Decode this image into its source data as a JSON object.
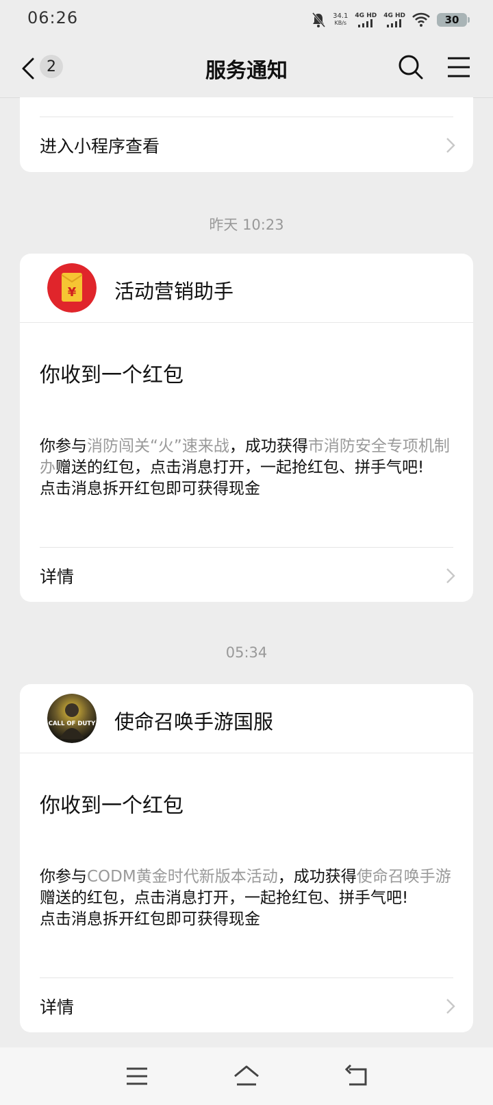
{
  "status_bar": {
    "time": "06:26",
    "net_speed_value": "34.1",
    "net_speed_unit": "KB/s",
    "sim1_label": "4G HD",
    "sim2_label": "4G HD",
    "battery": "30"
  },
  "nav": {
    "badge_count": "2",
    "title": "服务通知",
    "icons": [
      "back-icon",
      "search-icon",
      "menu-icon"
    ]
  },
  "top_card": {
    "link_label": "进入小程序查看"
  },
  "messages": [
    {
      "time": "昨天 10:23",
      "sender": "活动营销助手",
      "avatar_icon": "red-envelope-icon",
      "title": "你收到一个红包",
      "body_parts": [
        "你参与",
        "消防闯关“火”速来战",
        "，成功获得",
        "市消防安全专项机制办",
        "赠送的红包，点击消息打开，一起抢红包、拼手气吧!"
      ],
      "body_line2": "点击消息拆开红包即可获得现金",
      "detail_label": "详情"
    },
    {
      "time": "05:34",
      "sender": "使命召唤手游国服",
      "avatar_icon": "call-of-duty-logo",
      "avatar_text": "CALL OF DUTY",
      "title": "你收到一个红包",
      "body_parts": [
        "你参与",
        "CODM黄金时代新版本活动",
        "，成功获得",
        "使命召唤手游",
        "赠送的红包，点击消息打开，一起抢红包、拼手气吧!"
      ],
      "body_line2": "点击消息拆开红包即可获得现金",
      "detail_label": "详情"
    }
  ],
  "colors": {
    "background": "#ededed",
    "card": "#ffffff",
    "highlight_text": "#9a9a9a",
    "red_envelope": "#e0252b",
    "envelope_yellow": "#f6c533"
  },
  "system_nav": {
    "icons": [
      "menu-lines-icon",
      "home-icon",
      "back-return-icon"
    ]
  }
}
